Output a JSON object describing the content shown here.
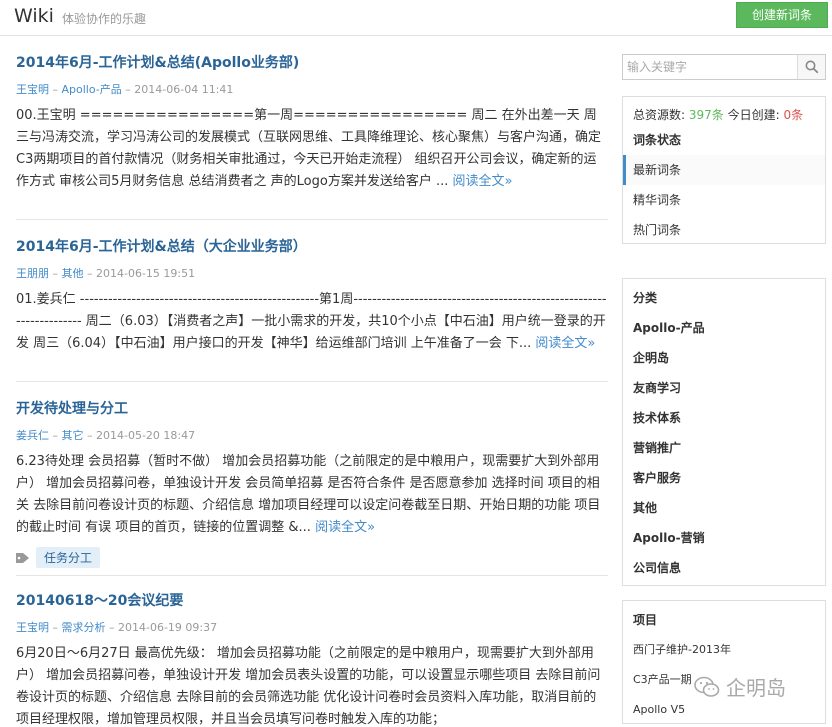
{
  "header": {
    "logo": "Wiki",
    "slogan": "体验协作的乐趣",
    "create_button": "创建新词条"
  },
  "posts": [
    {
      "title": "2014年6月-工作计划&总结(Apollo业务部)",
      "author": "王宝明",
      "category": "Apollo-产品",
      "date": "2014-06-04 11:41",
      "body": "00.王宝明 ================第一周================ 周二 在外出差一天 周三与冯涛交流，学习冯涛公司的发展模式（互联网思维、工具降维理论、核心聚焦）与客户沟通，确定C3两期项目的首付款情况（财务相关审批通过，今天已开始走流程） 组织召开公司会议，确定新的运作方式 审核公司5月财务信息 总结消费者之 声的Logo方案并发送给客户 ... ",
      "more": "阅读全文»"
    },
    {
      "title": "2014年6月-工作计划&总结（大企业业务部）",
      "author": "王朋朋",
      "category": "其他",
      "date": "2014-06-15 19:51",
      "body": "01.姜兵仁 ---------------------------------------------------第1周-------------------------------------------------------------------- 周二（6.03）【消费者之声】一批小需求的开发，共10个小点【中石油】用户统一登录的开发 周三（6.04）【中石油】用户接口的开发【神华】给运维部门培训 上午准备了一会 下... ",
      "more": "阅读全文»"
    },
    {
      "title": "开发待处理与分工",
      "author": "姜兵仁",
      "category": "其它",
      "date": "2014-05-20 18:47",
      "body": "6.23待处理 会员招募（暂时不做） 增加会员招募功能（之前限定的是中粮用户，现需要扩大到外部用户） 增加会员招募问卷，单独设计开发 会员简单招募 是否符合条件 是否愿意参加 选择时间 项目的相关 去除目前问卷设计页的标题、介绍信息 增加项目经理可以设定问卷截至日期、开始日期的功能 项目的截止时间 有误 项目的首页，链接的位置调整 &... ",
      "more": "阅读全文»",
      "tag": "任务分工"
    },
    {
      "title": "20140618～20会议纪要",
      "author": "王宝明",
      "category": "需求分析",
      "date": "2014-06-19 09:37",
      "body": "6月20日～6月27日 最高优先级： 增加会员招募功能（之前限定的是中粮用户，现需要扩大到外部用户） 增加会员招募问卷，单独设计开发 增加会员表头设置的功能，可以设置显示哪些项目 去除目前问卷设计页的标题、介绍信息 去除目前的会员筛选功能 优化设计问卷时会员资料入库功能，取消目前的项目经理权限，增加管理员权限，并且当会员填写问卷时触发入库的功能；"
    }
  ],
  "sidebar": {
    "search_placeholder": "输入关键字",
    "stats": {
      "total_label": "总资源数:",
      "total_value": "397条",
      "today_label": "今日创建:",
      "today_value": "0条"
    },
    "status": {
      "heading": "词条状态",
      "items": [
        "最新词条",
        "精华词条",
        "热门词条"
      ]
    },
    "categories": {
      "heading": "分类",
      "items": [
        "Apollo-产品",
        "企明岛",
        "友商学习",
        "技术体系",
        "营销推广",
        "客户服务",
        "其他",
        "Apollo-营销",
        "公司信息"
      ]
    },
    "projects": {
      "heading": "项目",
      "items": [
        "西门子维护-2013年",
        "C3产品一期",
        "Apollo V5"
      ]
    }
  },
  "watermark": {
    "text": "企明岛"
  },
  "colors": {
    "link": "#2a6496",
    "meta_link": "#428bca",
    "create_button": "#5cb85c",
    "today_zero": "#d9534f"
  }
}
